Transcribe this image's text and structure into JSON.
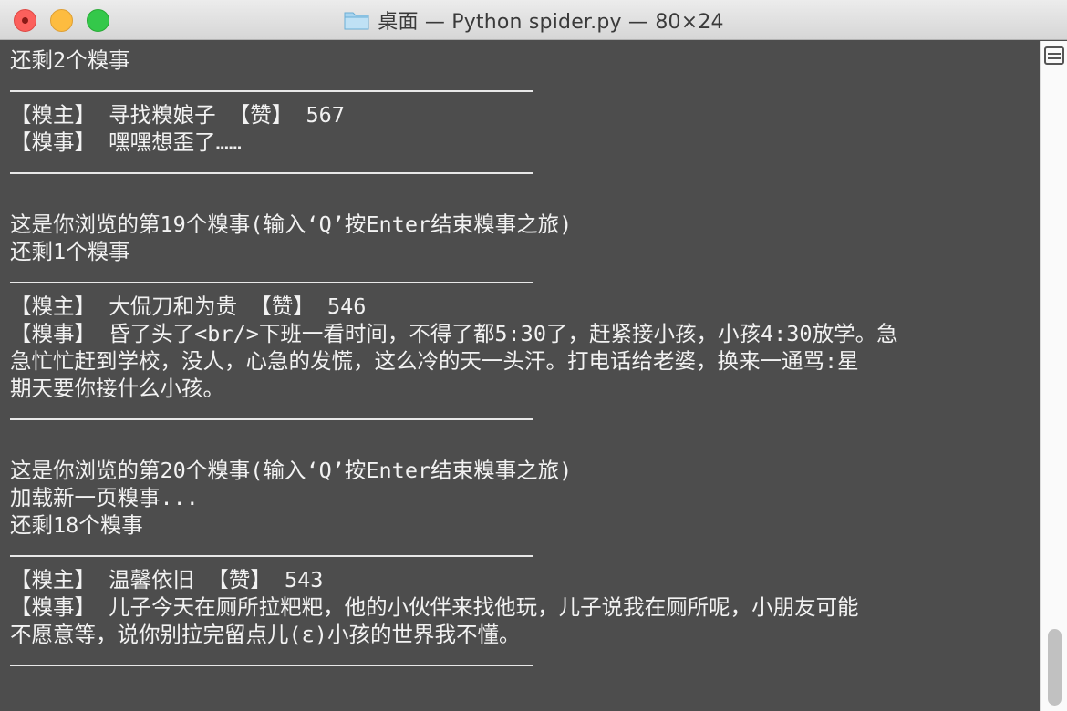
{
  "window": {
    "title": "桌面 — Python spider.py — 80×24",
    "folder_icon": "folder-icon",
    "colors": {
      "background": "#4d4d4d",
      "text": "#f2f2f2",
      "close": "#fc605c",
      "minimize": "#fdbc40",
      "maximize": "#34c84a"
    }
  },
  "terminal": {
    "lines": [
      {
        "type": "text",
        "text": "还剩2个糗事"
      },
      {
        "type": "rule"
      },
      {
        "type": "text",
        "text": "【糗主】 寻找糗娘子 【赞】 567"
      },
      {
        "type": "text",
        "text": "【糗事】 嘿嘿想歪了……"
      },
      {
        "type": "rule"
      },
      {
        "type": "blank"
      },
      {
        "type": "text",
        "text": "这是你浏览的第19个糗事(输入‘Q’按Enter结束糗事之旅)"
      },
      {
        "type": "text",
        "text": "还剩1个糗事"
      },
      {
        "type": "rule"
      },
      {
        "type": "text",
        "text": "【糗主】 大侃刀和为贵 【赞】 546"
      },
      {
        "type": "text",
        "text": "【糗事】 昏了头了<br/>下班一看时间，不得了都5:30了，赶紧接小孩，小孩4:30放学。急"
      },
      {
        "type": "text",
        "text": "急忙忙赶到学校，没人，心急的发慌，这么冷的天一头汗。打电话给老婆，换来一通骂:星"
      },
      {
        "type": "text",
        "text": "期天要你接什么小孩。"
      },
      {
        "type": "rule"
      },
      {
        "type": "blank"
      },
      {
        "type": "text",
        "text": "这是你浏览的第20个糗事(输入‘Q’按Enter结束糗事之旅)"
      },
      {
        "type": "text",
        "text": "加载新一页糗事..."
      },
      {
        "type": "text",
        "text": "还剩18个糗事"
      },
      {
        "type": "rule"
      },
      {
        "type": "text",
        "text": "【糗主】 温馨依旧 【赞】 543"
      },
      {
        "type": "text",
        "text": "【糗事】 儿子今天在厕所拉粑粑，他的小伙伴来找他玩，儿子说我在厕所呢，小朋友可能"
      },
      {
        "type": "text",
        "text": "不愿意等，说你别拉完留点儿(ε)小孩的世界我不懂。"
      },
      {
        "type": "rule"
      },
      {
        "type": "blank"
      }
    ]
  },
  "scrollbar": {
    "position_fraction": 0.92,
    "button_icon": "split-pane-icon"
  }
}
